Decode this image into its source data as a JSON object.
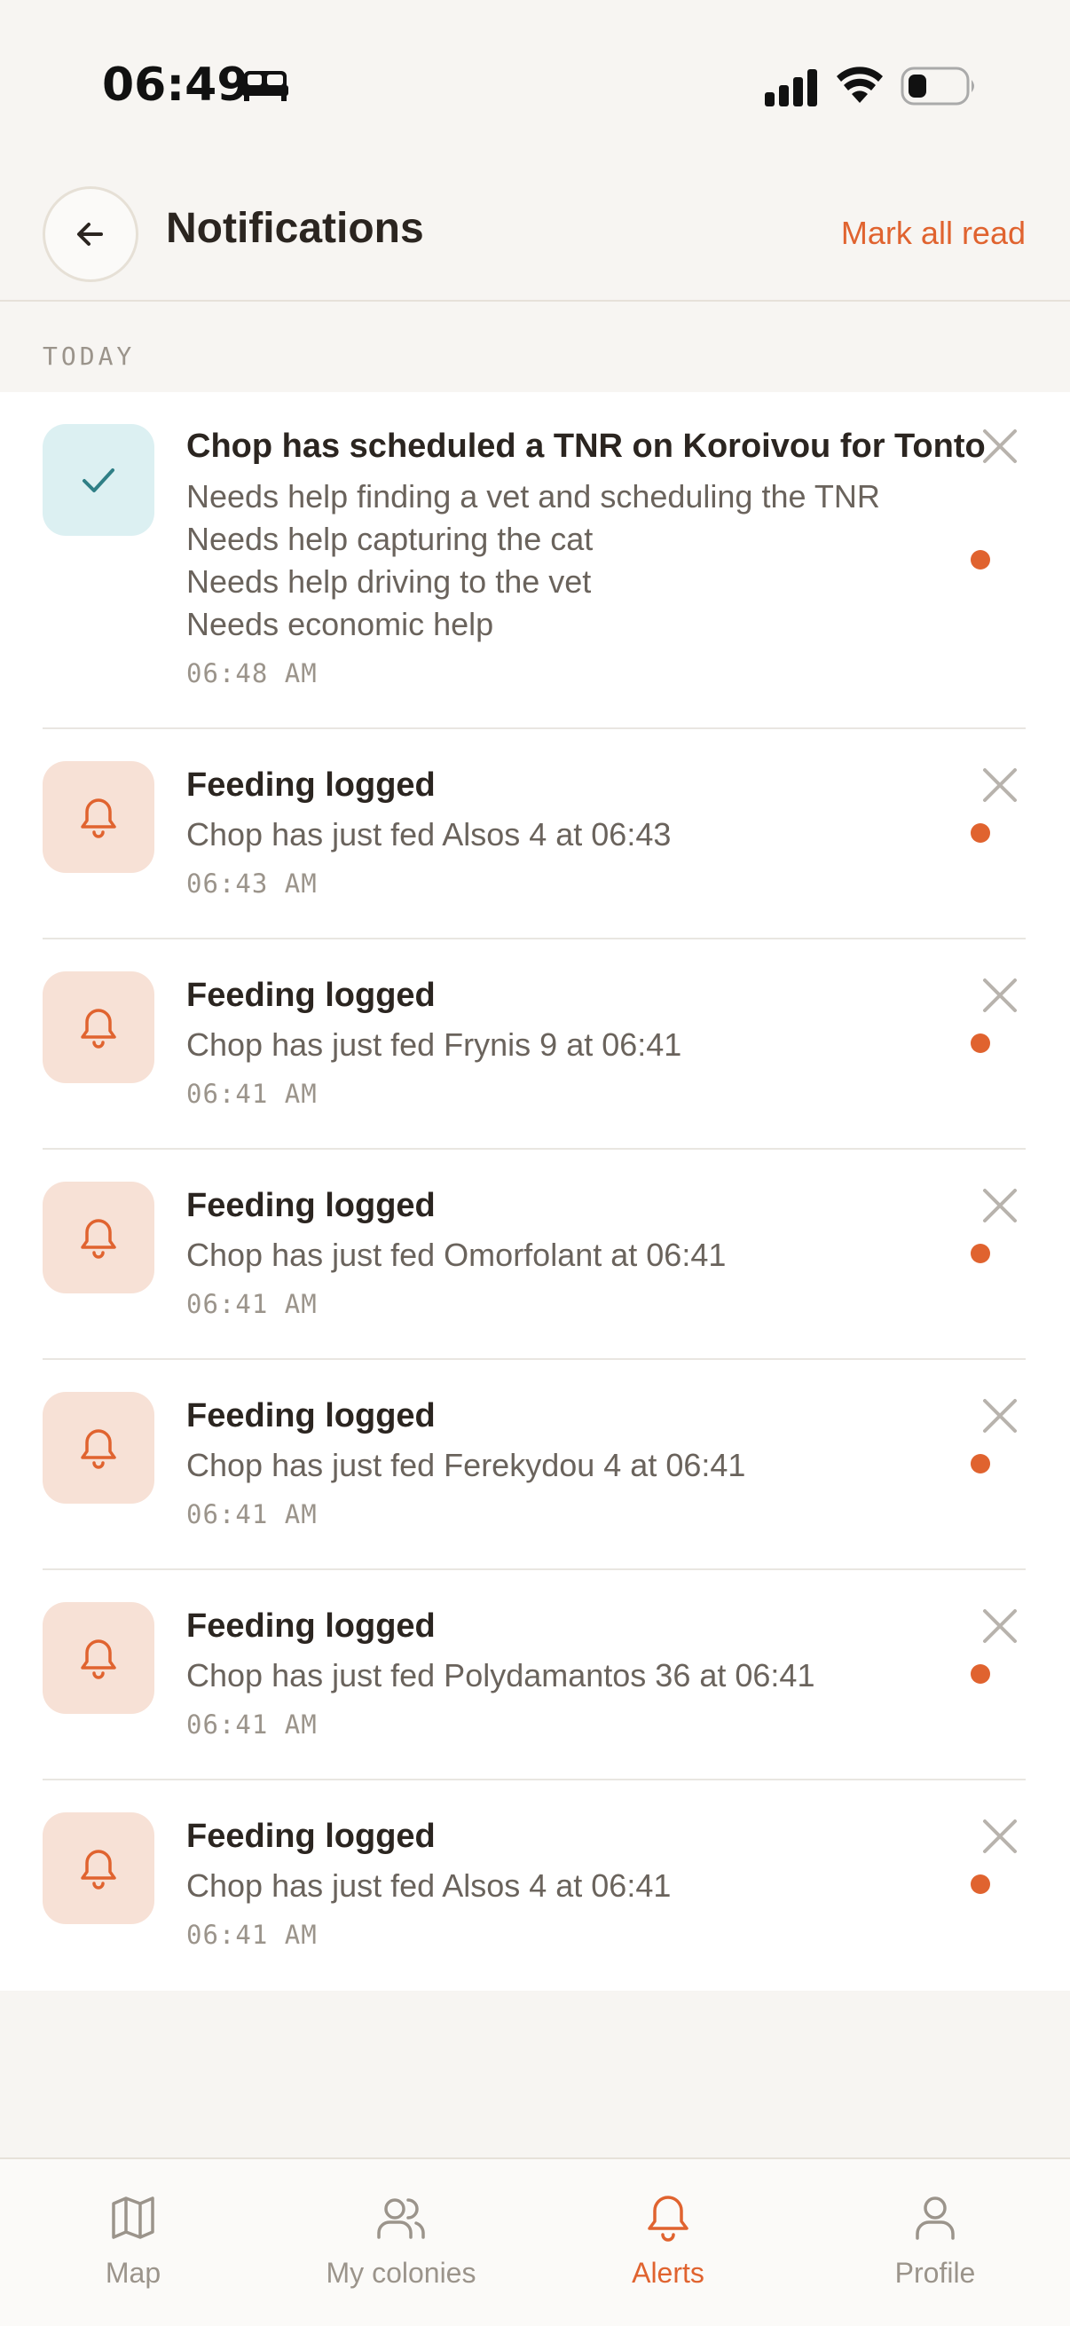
{
  "status_bar": {
    "time": "06:49",
    "icons": [
      "bed-icon",
      "signal-icon",
      "wifi-icon",
      "battery-icon"
    ]
  },
  "header": {
    "back_icon": "arrow-left-icon",
    "title": "Notifications",
    "mark_all_read": "Mark all read"
  },
  "section": {
    "label": "TODAY"
  },
  "colors": {
    "accent": "#e0632f",
    "teal": "#2f7f86",
    "bell_bg": "#f7e1d6",
    "check_bg": "#dcf0f2"
  },
  "notifications": [
    {
      "icon": "check-icon",
      "title": "Chop has scheduled a TNR on Koroivou for Tonto",
      "lines": [
        "Needs help finding a vet and scheduling the TNR",
        "Needs help capturing the cat",
        "Needs help driving to the vet",
        "Needs economic help"
      ],
      "time": "06:48 AM",
      "unread": true
    },
    {
      "icon": "bell-icon",
      "title": "Feeding logged",
      "lines": [
        "Chop has just fed Alsos 4 at 06:43"
      ],
      "time": "06:43 AM",
      "unread": true
    },
    {
      "icon": "bell-icon",
      "title": "Feeding logged",
      "lines": [
        "Chop has just fed Frynis 9 at 06:41"
      ],
      "time": "06:41 AM",
      "unread": true
    },
    {
      "icon": "bell-icon",
      "title": "Feeding logged",
      "lines": [
        "Chop has just fed Omorfolant at 06:41"
      ],
      "time": "06:41 AM",
      "unread": true
    },
    {
      "icon": "bell-icon",
      "title": "Feeding logged",
      "lines": [
        "Chop has just fed Ferekydou 4 at 06:41"
      ],
      "time": "06:41 AM",
      "unread": true
    },
    {
      "icon": "bell-icon",
      "title": "Feeding logged",
      "lines": [
        "Chop has just fed Polydamantos 36 at 06:41"
      ],
      "time": "06:41 AM",
      "unread": true
    },
    {
      "icon": "bell-icon",
      "title": "Feeding logged",
      "lines": [
        "Chop has just fed Alsos 4 at 06:41"
      ],
      "time": "06:41 AM",
      "unread": true
    }
  ],
  "tabbar": {
    "tabs": [
      {
        "label": "Map",
        "icon": "map-icon",
        "active": false
      },
      {
        "label": "My colonies",
        "icon": "users-icon",
        "active": false
      },
      {
        "label": "Alerts",
        "icon": "bell-icon",
        "active": true
      },
      {
        "label": "Profile",
        "icon": "user-icon",
        "active": false
      }
    ]
  }
}
